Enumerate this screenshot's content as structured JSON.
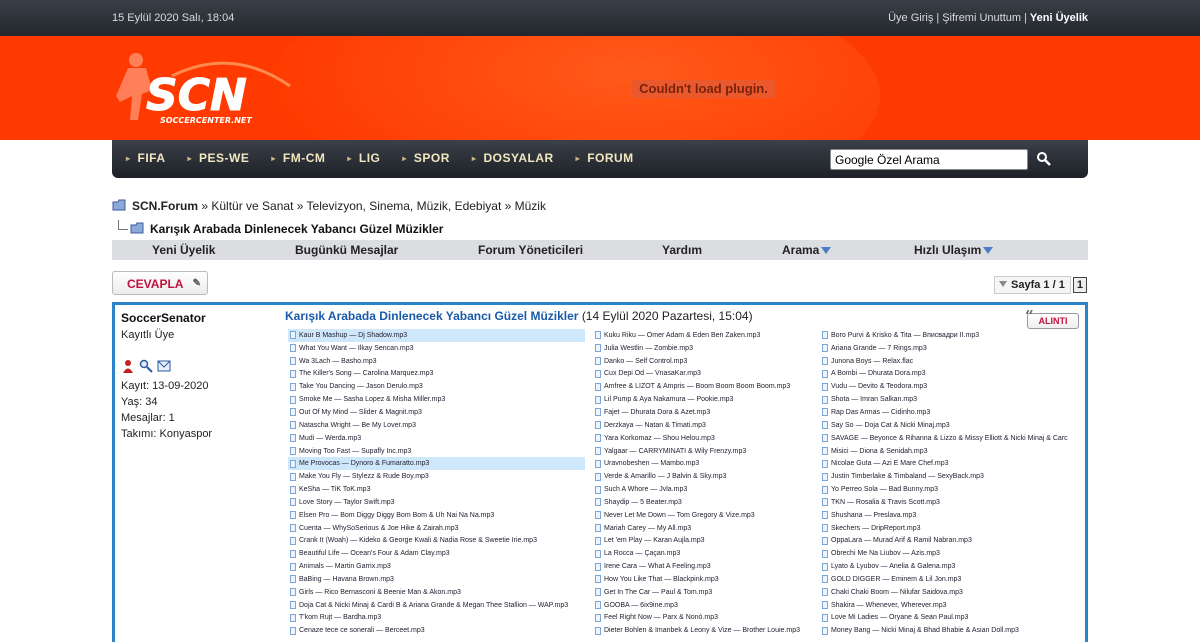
{
  "topbar": {
    "date": "15 Eylül 2020 Salı, 18:04",
    "login": "Üye Giriş",
    "forgot": "Şifremi Unuttum",
    "register": "Yeni Üyelik"
  },
  "banner": {
    "logo_text": "SCN",
    "logo_subtext": "SOCCERCENTER.NET",
    "plugin_message": "Couldn't load plugin."
  },
  "nav": {
    "items": [
      "FIFA",
      "PES-WE",
      "FM-CM",
      "LIG",
      "SPOR",
      "DOSYALAR",
      "FORUM"
    ],
    "search_value": "Google Özel Arama"
  },
  "breadcrumb": {
    "root": "SCN.Forum",
    "path": "» Kültür ve Sanat » Televizyon, Sinema, Müzik, Edebiyat » Müzik",
    "thread": "Karışık Arabada Dinlenecek Yabancı Güzel Müzikler"
  },
  "menu": {
    "register": "Yeni Üyelik",
    "today": "Bugünkü Mesajlar",
    "moderators": "Forum Yöneticileri",
    "help": "Yardım",
    "search": "Arama",
    "quick": "Hızlı Ulaşım"
  },
  "actions": {
    "reply": "CEVAPLA",
    "page_label": "Sayfa 1 / 1",
    "page_current": "1",
    "quote": "ALINTI"
  },
  "post": {
    "author": "SoccerSenator",
    "role": "Kayıtlı Üye",
    "joined": "Kayıt: 13-09-2020",
    "age": "Yaş: 34",
    "posts": "Mesajlar: 1",
    "team": "Takımı: Konyaspor",
    "title": "Karışık Arabada Dinlenecek Yabancı Güzel Müzikler",
    "date": "(14 Eylül 2020 Pazartesi, 15:04)"
  },
  "files": {
    "col1": [
      "Kaur B Mashup — Dj Shadow.mp3",
      "What You Want — Ilkay Sencan.mp3",
      "Wa 3Lach — Basho.mp3",
      "The Killer's Song — Carolina Marquez.mp3",
      "Take You Dancing — Jason Derulo.mp3",
      "Smoke Me — Sasha Lopez & Misha Miller.mp3",
      "Out Of My Mind — Slider & Magnit.mp3",
      "Natascha Wright — Be My Lover.mp3",
      "Mudi — Werda.mp3",
      "Moving Too Fast — Supafly Inc.mp3",
      "Me Provocas — Dynoro & Fumaratto.mp3",
      "Make You Fly — Stylezz & Rude Boy.mp3",
      "KeSha — TiK ToK.mp3",
      "Love Story — Taylor Swift.mp3",
      "Elsen Pro — Bom Diggy Diggy Bom Bom & Uh Nai Na Na.mp3",
      "Cuenta — WhySoSerious & Joe Hike & Zairah.mp3",
      "Crank It (Woah) — Kideko & George Kwali & Nadia Rose & Sweetie Irie.mp3",
      "Beautiful Life — Ocean's Four & Adam Clay.mp3",
      "Animals — Martin Garrix.mp3",
      "BaBing — Havana Brown.mp3",
      "Girls — Rico Bernasconi & Beenie Man & Akon.mp3",
      "Doja Cat & Nicki Minaj & Cardi B & Ariana Grande & Megan Thee Stallion — WAP.mp3",
      "T'kom Rujt — Bardha.mp3",
      "Cenaze tece ce sonerali — Berceet.mp3"
    ],
    "col2": [
      "Kuku Riku — Omer Adam & Eden Ben Zaken.mp3",
      "Julia Westlin — Zombie.mp3",
      "Danko — Self Control.mp3",
      "Cux Depi Od — VnasaKar.mp3",
      "Amfree & LIZOT & Ampris — Boom Boom Boom Boom.mp3",
      "Lil Pump & Aya Nakamura — Pookie.mp3",
      "Fajet — Dhurata Dora & Azet.mp3",
      "Derzkaya — Natan & Timati.mp3",
      "Yara Korkomaz — Shou Helou.mp3",
      "Yalgaar — CARRYMINATI & Wily Frenzy.mp3",
      "Uravnobeshen — Mambo.mp3",
      "Verde & Amarillo — J Balvin & Sky.mp3",
      "Such A Whore — Jvla.mp3",
      "Shaydip — 5 Beater.mp3",
      "Never Let Me Down — Tom Gregory & Vize.mp3",
      "Mariah Carey — My All.mp3",
      "Let 'em Play — Karan Aujla.mp3",
      "La Rocca — Çaçan.mp3",
      "Irene Cara — What A Feeling.mp3",
      "How You Like That — Blackpink.mp3",
      "Get In The Car — Paul & Tom.mp3",
      "GOOBA — 6ix9ine.mp3",
      "Feel Right Now — Parx & Nonó.mp3",
      "Dieter Bohlen & Imanbek & Leony & Vize — Brother Louie.mp3"
    ],
    "col3": [
      "Boro Purvi & Krisko & Tita — Вписвадри II.mp3",
      "Ariana Grande — 7 Rings.mp3",
      "Junona Boys — Relax.flac",
      "A Bombi — Dhurata Dora.mp3",
      "Vudu — Devito & Teodora.mp3",
      "Shota — Imran Salkan.mp3",
      "Rap Das Armas — Cidinho.mp3",
      "Say So — Doja Cat & Nicki Minaj.mp3",
      "SAVAGE — Beyonce & Rihanna & Lizzo & Missy Elliott & Nicki Minaj & Carc",
      "Misici — Diona & Senidah.mp3",
      "Nicolae Guta — Azi E Mare Chef.mp3",
      "Justin Timberlake & Timbaland — SexyBack.mp3",
      "Yo Perreo Sola — Bad Bunny.mp3",
      "TKN — Rosalia & Travis Scott.mp3",
      "Shushana — Preslava.mp3",
      "Skechers — DripReport.mp3",
      "OppaLara — Murad Arif & Ramil Nabran.mp3",
      "Obrechi Me Na Liubov — Azis.mp3",
      "Lyato & Lyubov — Anelia & Galena.mp3",
      "GOLD DIGGER — Eminem & Lil Jon.mp3",
      "Chaki Chaki Boom — Nilufar Saidova.mp3",
      "Shakira — Whenever, Wherever.mp3",
      "Love Mi Ladies — Oryane & Sean Paul.mp3",
      "Money Bang — Nicki Minaj & Bhad Bhabie & Asian Doll.mp3"
    ]
  },
  "colors": {
    "banner": "#ff3a00",
    "post_border": "#2a85c8",
    "accent_red": "#c0123c",
    "link_blue": "#1a5aa8"
  }
}
